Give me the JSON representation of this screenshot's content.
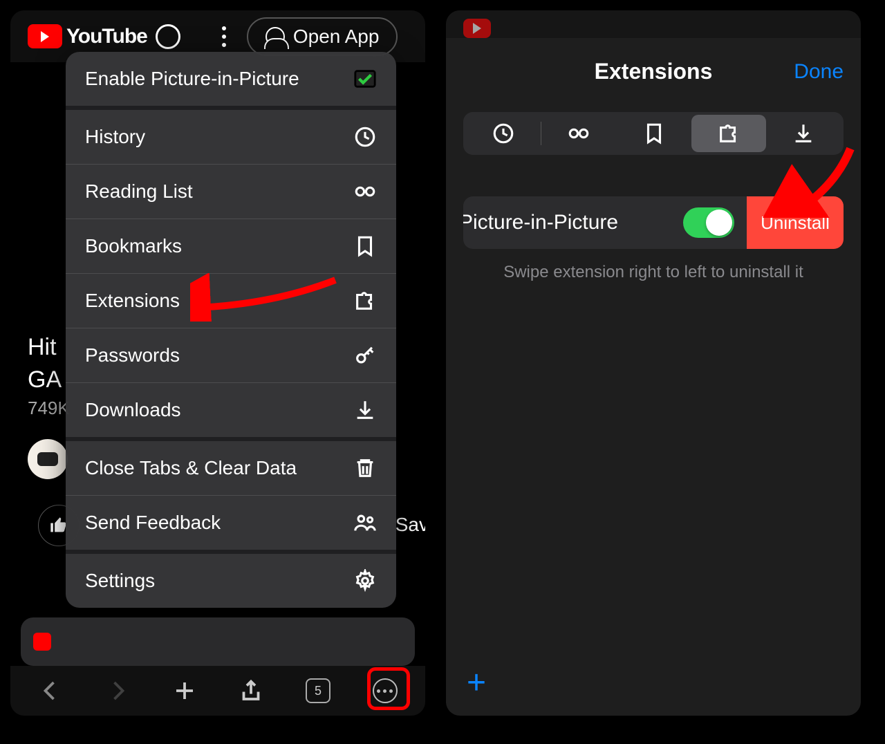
{
  "left": {
    "yt_brand": "YouTube",
    "open_app": "Open App",
    "video_line1": "Hit",
    "video_line2": "GA",
    "views": "749K",
    "save_label": "Sav",
    "tab_count": "5",
    "menu": {
      "pip": "Enable Picture-in-Picture",
      "history": "History",
      "reading": "Reading List",
      "bookmarks": "Bookmarks",
      "extensions": "Extensions",
      "passwords": "Passwords",
      "downloads": "Downloads",
      "close_clear": "Close Tabs & Clear Data",
      "feedback": "Send Feedback",
      "settings": "Settings"
    }
  },
  "right": {
    "title": "Extensions",
    "done": "Done",
    "ext_name": "Picture-in-Picture",
    "uninstall": "Uninstall",
    "hint": "Swipe extension right to left to uninstall it",
    "add": "+"
  }
}
